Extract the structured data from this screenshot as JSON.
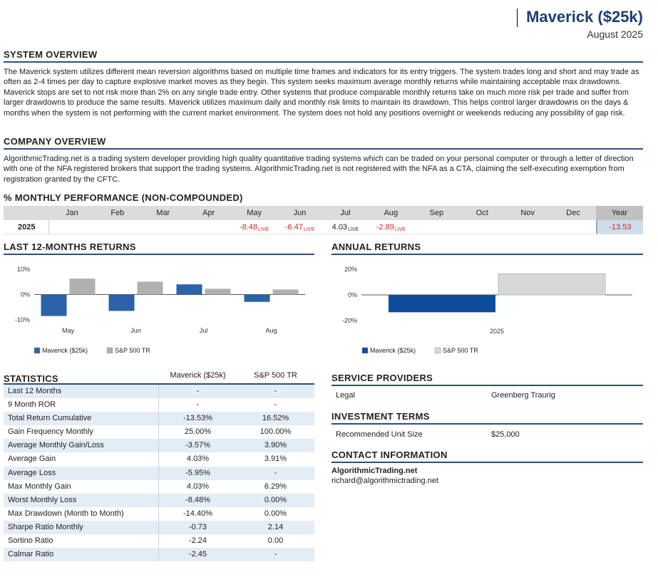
{
  "header": {
    "title": "Maverick ($25k)",
    "date": "August 2025"
  },
  "system_overview": {
    "heading": "SYSTEM OVERVIEW",
    "text": "The Maverick system utilizes different mean reversion algorithms based on multiple time frames and indicators for its entry triggers. The system trades long and short and may trade as often as 2-4 times per day to capture explosive market moves as they begin. This system seeks maximum average monthly returns while maintaining acceptable max drawdowns. Maverick stops are set to not risk more than 2% on any single trade entry. Other systems that produce comparable monthly returns take on much more risk per trade and suffer from larger drawdowns to produce the same results. Maverick utilizes maximum daily and monthly risk limits to maintain its drawdown. This helps control larger drawdowns on the days & months when the system is not performing with the current market environment. The system does not hold any positions overnight or weekends reducing any possibility of gap risk."
  },
  "company_overview": {
    "heading": "COMPANY OVERVIEW",
    "text": "AlgorithmicTrading.net is a trading system developer providing high quality quantitative trading systems which can be traded on your personal computer or through a letter of direction with one of the NFA registered brokers that support the trading systems. AlgorithmicTrading.net is not registered with the NFA as a CTA, claiming the self-executing exemption from registration granted by the CFTC."
  },
  "monthly_performance": {
    "heading": "% MONTHLY PERFORMANCE (NON-COMPOUNDED)",
    "months": [
      "Jan",
      "Feb",
      "Mar",
      "Apr",
      "May",
      "Jun",
      "Jul",
      "Aug",
      "Sep",
      "Oct",
      "Nov",
      "Dec"
    ],
    "year_label": "Year",
    "row": {
      "year": "2025",
      "values": [
        "",
        "",
        "",
        "",
        "-8.48",
        "-6.47",
        "4.03",
        "-2.89",
        "",
        "",
        "",
        ""
      ],
      "live": [
        "",
        "",
        "",
        "",
        "LIVE",
        "LIVE",
        "LIVE",
        "LIVE",
        "",
        "",
        "",
        ""
      ],
      "total": "-13.53"
    }
  },
  "last12": {
    "heading": "LAST 12-MONTHS RETURNS",
    "legend": [
      "Maverick ($25k)",
      "S&P 500 TR"
    ]
  },
  "annual": {
    "heading": "ANNUAL RETURNS",
    "legend": [
      "Maverick ($25k)",
      "S&P 500 TR"
    ]
  },
  "chart_data": [
    {
      "type": "bar",
      "title": "LAST 12-MONTHS RETURNS",
      "categories": [
        "May",
        "Jun",
        "Jul",
        "Aug"
      ],
      "series": [
        {
          "name": "Maverick ($25k)",
          "values": [
            -8.48,
            -6.47,
            4.03,
            -2.89
          ],
          "color": "#2b62a8"
        },
        {
          "name": "S&P 500 TR",
          "values": [
            6.3,
            5.1,
            2.3,
            2.0
          ],
          "color": "#b0b0b0"
        }
      ],
      "yticks": [
        "10%",
        "0%",
        "-10%"
      ],
      "ylim": [
        -10,
        10
      ],
      "legend": "bottom-left"
    },
    {
      "type": "bar",
      "title": "ANNUAL RETURNS",
      "categories": [
        "2025"
      ],
      "series": [
        {
          "name": "Maverick ($25k)",
          "values": [
            -13.53
          ],
          "color": "#0d4d9c"
        },
        {
          "name": "S&P 500 TR",
          "values": [
            16.52
          ],
          "color": "#d8d8d8"
        }
      ],
      "yticks": [
        "20%",
        "0%",
        "-20%"
      ],
      "ylim": [
        -20,
        20
      ],
      "legend": "bottom-left"
    }
  ],
  "statistics": {
    "heading": "STATISTICS",
    "col1": "Maverick ($25k)",
    "col2": "S&P 500 TR",
    "rows": [
      {
        "label": "Last 12 Months",
        "v1": "-",
        "v2": "-"
      },
      {
        "label": "9 Month ROR",
        "v1": "-",
        "v2": "-"
      },
      {
        "label": "Total Return Cumulative",
        "v1": "-13.53%",
        "v2": "16.52%"
      },
      {
        "label": "Gain Frequency Monthly",
        "v1": "25.00%",
        "v2": "100.00%"
      },
      {
        "label": "Average Monthly Gain/Loss",
        "v1": "-3.57%",
        "v2": "3.90%"
      },
      {
        "label": "Average Gain",
        "v1": "4.03%",
        "v2": "3.91%"
      },
      {
        "label": "Average Loss",
        "v1": "-5.95%",
        "v2": "-"
      },
      {
        "label": "Max Monthly Gain",
        "v1": "4.03%",
        "v2": "6.29%"
      },
      {
        "label": "Worst Monthly Loss",
        "v1": "-8.48%",
        "v2": "0.00%"
      },
      {
        "label": "Max Drawdown (Month to Month)",
        "v1": "-14.40%",
        "v2": "0.00%"
      },
      {
        "label": "Sharpe Ratio Monthly",
        "v1": "-0.73",
        "v2": "2.14"
      },
      {
        "label": "Sortino Ratio",
        "v1": "-2.24",
        "v2": "0.00"
      },
      {
        "label": "Calmar Ratio",
        "v1": "-2.45",
        "v2": "-"
      }
    ]
  },
  "service_providers": {
    "heading": "SERVICE PROVIDERS",
    "label": "Legal",
    "value": "Greenberg Traurig"
  },
  "investment_terms": {
    "heading": "INVESTMENT TERMS",
    "label": "Recommended Unit Size",
    "value": "$25,000"
  },
  "contact": {
    "heading": "CONTACT INFORMATION",
    "company": "AlgorithmicTrading.net",
    "email": "richard@algorithmictrading.net"
  }
}
